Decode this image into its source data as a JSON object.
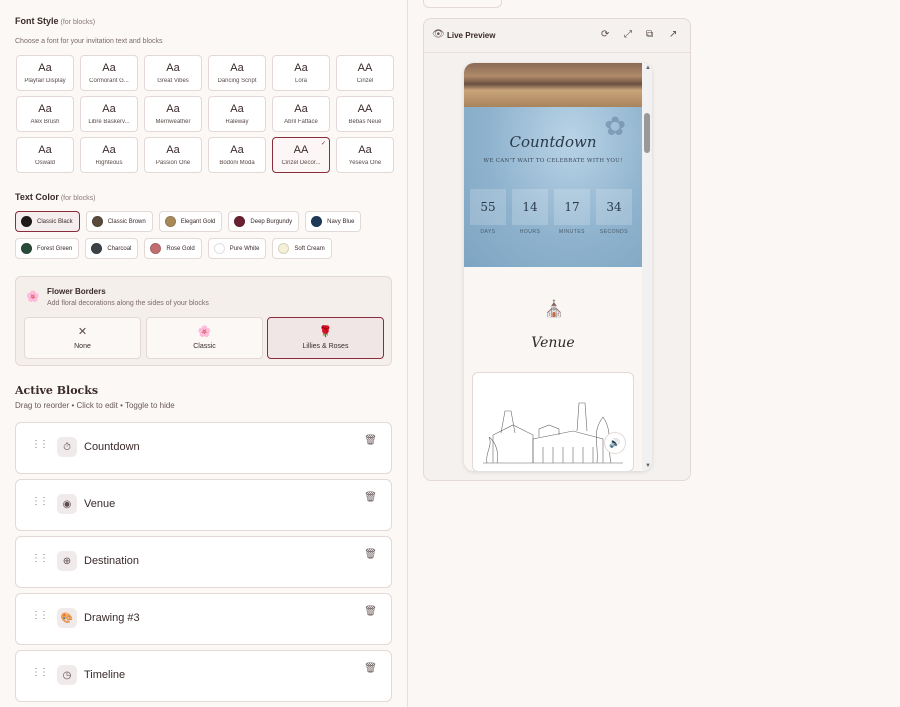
{
  "font_style": {
    "title": "Font Style",
    "hint": "(for blocks)",
    "subtitle": "Choose a font for your invitation text and blocks",
    "fonts": [
      {
        "sample": "Aa",
        "name": "Playfair Display"
      },
      {
        "sample": "Aa",
        "name": "Cormorant G..."
      },
      {
        "sample": "Aa",
        "name": "Great Vibes"
      },
      {
        "sample": "Aa",
        "name": "Dancing Script"
      },
      {
        "sample": "Aa",
        "name": "Lora"
      },
      {
        "sample": "AA",
        "name": "Cinzel"
      },
      {
        "sample": "Aa",
        "name": "Alex Brush"
      },
      {
        "sample": "Aa",
        "name": "Libre Baskerv..."
      },
      {
        "sample": "Aa",
        "name": "Merriweather"
      },
      {
        "sample": "Aa",
        "name": "Raleway"
      },
      {
        "sample": "Aa",
        "name": "Abril Fatface"
      },
      {
        "sample": "AA",
        "name": "Bebas Neue"
      },
      {
        "sample": "Aa",
        "name": "Oswald"
      },
      {
        "sample": "Aa",
        "name": "Righteous"
      },
      {
        "sample": "Aa",
        "name": "Passion One"
      },
      {
        "sample": "Aa",
        "name": "Bodoni Moda"
      },
      {
        "sample": "AA",
        "name": "Cinzel Decor..."
      },
      {
        "sample": "Aa",
        "name": "Yeseva One"
      }
    ],
    "selected_font": "Cinzel Decor...",
    "check": "✓"
  },
  "text_color": {
    "title": "Text Color",
    "hint": "(for blocks)",
    "colors": [
      {
        "name": "Classic Black",
        "hex": "#1f1a1a"
      },
      {
        "name": "Classic Brown",
        "hex": "#5a4a3a"
      },
      {
        "name": "Elegant Gold",
        "hex": "#a88a5a"
      },
      {
        "name": "Deep Burgundy",
        "hex": "#6a2030"
      },
      {
        "name": "Navy Blue",
        "hex": "#1e3a5a"
      },
      {
        "name": "Forest Green",
        "hex": "#2a4a3a"
      },
      {
        "name": "Charcoal",
        "hex": "#3a4248"
      },
      {
        "name": "Rose Gold",
        "hex": "#c07070"
      },
      {
        "name": "Pure White",
        "hex": "#ffffff"
      },
      {
        "name": "Soft Cream",
        "hex": "#f5f0d8"
      }
    ],
    "selected_color": "Classic Black"
  },
  "flower_borders": {
    "icon": "🌸",
    "title": "Flower Borders",
    "subtitle": "Add floral decorations along the sides of your blocks",
    "options": [
      {
        "icon": "✕",
        "label": "None"
      },
      {
        "icon": "🌸",
        "label": "Classic"
      },
      {
        "icon": "🌹",
        "label": "Lillies & Roses"
      }
    ],
    "selected": "Lillies & Roses"
  },
  "active_blocks": {
    "title": "Active Blocks",
    "subtitle": "Drag to reorder • Click to edit • Toggle to hide",
    "blocks": [
      {
        "icon": "⏱",
        "name": "Countdown"
      },
      {
        "icon": "◉",
        "name": "Venue"
      },
      {
        "icon": "⊕",
        "name": "Destination"
      },
      {
        "icon": "🎨",
        "name": "Drawing #3"
      },
      {
        "icon": "◷",
        "name": "Timeline"
      }
    ],
    "drag_glyph": "⋮⋮",
    "trash_glyph": "🗑"
  },
  "preview": {
    "title": "Live Preview",
    "eye": "👁",
    "actions": {
      "refresh": "⟳",
      "expand": "⤢",
      "copy": "⧉",
      "open": "↗"
    },
    "countdown": {
      "title": "Countdown",
      "subtitle": "WE CAN'T WAIT TO CELEBRATE WITH YOU!",
      "values": [
        "55",
        "14",
        "17",
        "34"
      ],
      "labels": [
        "DAYS",
        "HOURS",
        "MINUTES",
        "SECONDS"
      ]
    },
    "venue": {
      "title": "Venue",
      "icon": "⛪"
    },
    "sound": "🔊",
    "scroll_up": "▲",
    "scroll_down": "▼"
  }
}
